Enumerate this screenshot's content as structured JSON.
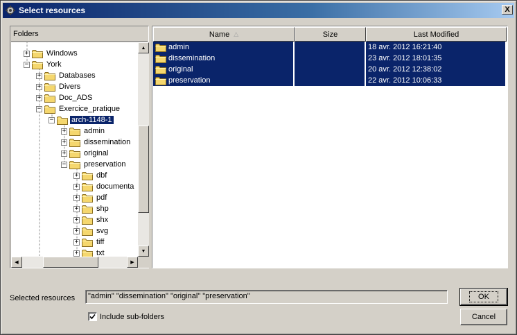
{
  "window": {
    "title": "Select resources",
    "close_label": "X"
  },
  "folders": {
    "header": "Folders",
    "rows": [
      {
        "label": "Windows",
        "expander": "+",
        "depth": 1
      },
      {
        "label": "York",
        "expander": "−",
        "depth": 1
      },
      {
        "label": "Databases",
        "expander": "+",
        "depth": 2
      },
      {
        "label": "Divers",
        "expander": "+",
        "depth": 2
      },
      {
        "label": "Doc_ADS",
        "expander": "+",
        "depth": 2
      },
      {
        "label": "Exercice_pratique",
        "expander": "−",
        "depth": 2
      },
      {
        "label": "arch-1148-1",
        "expander": "−",
        "depth": 3,
        "selected": true
      },
      {
        "label": "admin",
        "expander": "+",
        "depth": 4
      },
      {
        "label": "dissemination",
        "expander": "+",
        "depth": 4
      },
      {
        "label": "original",
        "expander": "+",
        "depth": 4
      },
      {
        "label": "preservation",
        "expander": "−",
        "depth": 4
      },
      {
        "label": "dbf",
        "expander": "+",
        "depth": 5
      },
      {
        "label": "documenta",
        "expander": "+",
        "depth": 5
      },
      {
        "label": "pdf",
        "expander": "+",
        "depth": 5
      },
      {
        "label": "shp",
        "expander": "+",
        "depth": 5
      },
      {
        "label": "shx",
        "expander": "+",
        "depth": 5
      },
      {
        "label": "svg",
        "expander": "+",
        "depth": 5
      },
      {
        "label": "tiff",
        "expander": "+",
        "depth": 5
      },
      {
        "label": "txt",
        "expander": "+",
        "depth": 5
      }
    ]
  },
  "table": {
    "columns": [
      {
        "key": "name",
        "label": "Name",
        "sort": "△"
      },
      {
        "key": "size",
        "label": "Size"
      },
      {
        "key": "modified",
        "label": "Last Modified"
      }
    ],
    "rows": [
      {
        "name": "admin",
        "size": "",
        "modified": "18 avr. 2012 16:21:40"
      },
      {
        "name": "dissemination",
        "size": "",
        "modified": "23 avr. 2012 18:01:35"
      },
      {
        "name": "original",
        "size": "",
        "modified": "20 avr. 2012 12:38:02"
      },
      {
        "name": "preservation",
        "size": "",
        "modified": "22 avr. 2012 10:06:33"
      }
    ]
  },
  "bottom": {
    "selected_label": "Selected resources",
    "selected_value": "\"admin\" \"dissemination\" \"original\" \"preservation\"",
    "include_subfolders_label": "Include sub-folders",
    "include_subfolders_checked": true,
    "ok_label": "OK",
    "cancel_label": "Cancel"
  },
  "colors": {
    "selection": "#0a246a",
    "face": "#d4d0c8",
    "folder": "#f5d76e"
  },
  "icons": {
    "folder": "folder-icon",
    "app": "gear-icon",
    "check": "check-icon"
  }
}
